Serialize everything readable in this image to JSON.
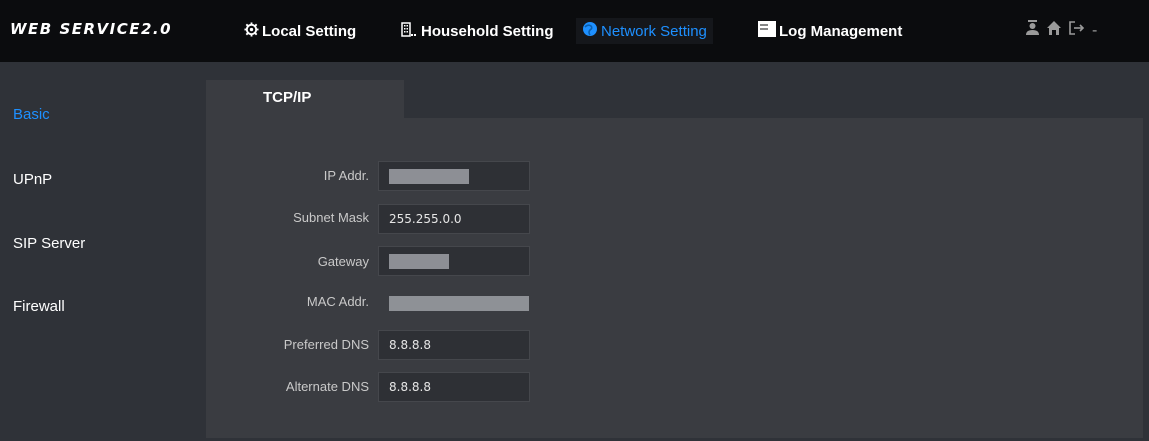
{
  "header": {
    "logo": "WEB SERVICE2.0",
    "nav": [
      {
        "label": "Local Setting",
        "icon": "gear-icon"
      },
      {
        "label": "Household Setting",
        "icon": "building-icon"
      },
      {
        "label": "Network Setting",
        "icon": "globe-icon",
        "active": true
      },
      {
        "label": "Log Management",
        "icon": "log-icon"
      }
    ],
    "right_icons": [
      "user-icon",
      "home-icon",
      "logout-icon"
    ],
    "right_sep": "-"
  },
  "sidebar": {
    "items": [
      {
        "label": "Basic",
        "active": true
      },
      {
        "label": "UPnP"
      },
      {
        "label": "SIP Server"
      },
      {
        "label": "Firewall"
      }
    ]
  },
  "tab": {
    "label": "TCP/IP"
  },
  "form": {
    "ip": {
      "label": "IP Addr.",
      "value": ""
    },
    "subnet": {
      "label": "Subnet Mask",
      "value": "255.255.0.0"
    },
    "gateway": {
      "label": "Gateway",
      "value": ""
    },
    "mac": {
      "label": "MAC Addr.",
      "value": ""
    },
    "dns1": {
      "label": "Preferred DNS",
      "value": "8.8.8.8"
    },
    "dns2": {
      "label": "Alternate DNS",
      "value": "8.8.8.8"
    }
  },
  "colors": {
    "accent": "#1e90ff",
    "topbar": "#0b0c0e",
    "background": "#2f3238",
    "panel": "#3a3c41"
  }
}
